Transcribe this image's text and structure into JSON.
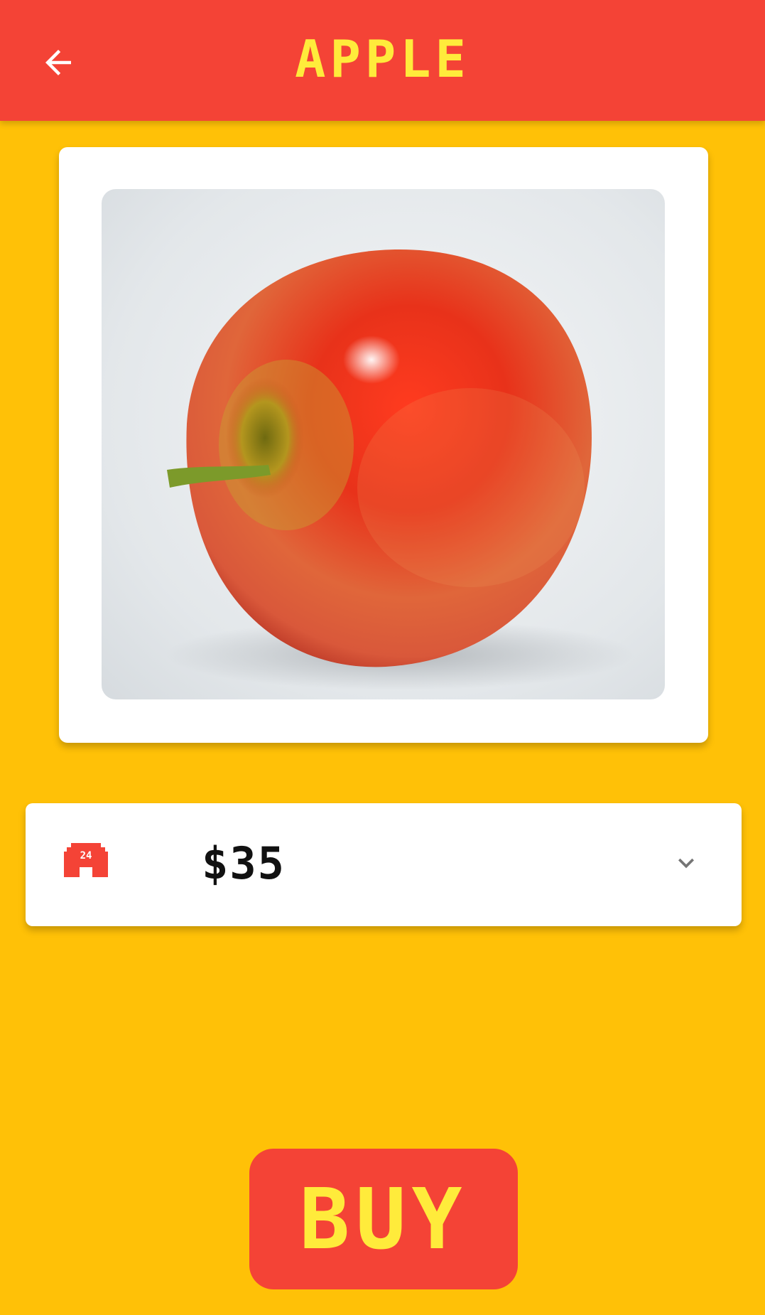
{
  "header": {
    "title": "APPLE",
    "back_icon": "arrow-back-icon",
    "background_color": "#F44336",
    "title_color": "#FFEB3B"
  },
  "product": {
    "image_subject": "red apple"
  },
  "price_selector": {
    "icon": "coin-24-icon",
    "icon_text": "24",
    "value": "$35",
    "expand_icon": "chevron-down-icon"
  },
  "actions": {
    "buy_label": "BUY"
  },
  "colors": {
    "page_background": "#FFC107",
    "accent": "#F44336",
    "accent_text": "#FFEB3B"
  }
}
